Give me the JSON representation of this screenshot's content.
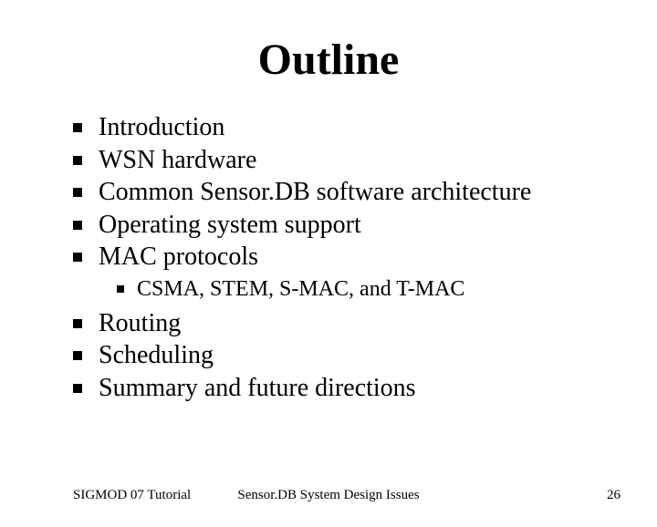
{
  "title": "Outline",
  "items": [
    {
      "text": "Introduction"
    },
    {
      "text": "WSN hardware"
    },
    {
      "text": "Common Sensor.DB software architecture"
    },
    {
      "text": "Operating system support"
    },
    {
      "text": "MAC protocols"
    }
  ],
  "subitem": {
    "text": "CSMA, STEM, S-MAC, and T-MAC"
  },
  "items2": [
    {
      "text": "Routing"
    },
    {
      "text": "Scheduling"
    },
    {
      "text": "Summary and future directions"
    }
  ],
  "footer": {
    "left": "SIGMOD 07 Tutorial",
    "center": "Sensor.DB System Design Issues",
    "right": "26"
  }
}
